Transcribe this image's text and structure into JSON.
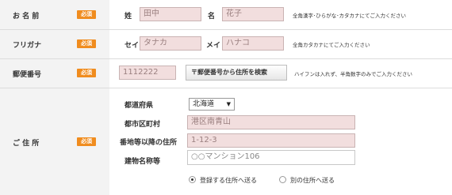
{
  "required_badge": "必須",
  "name": {
    "label": "お 名 前",
    "last_label": "姓",
    "last_value": "田中",
    "first_label": "名",
    "first_value": "花子",
    "hint": "全角漢字･ひらがな･カタカナにてご入力ください"
  },
  "kana": {
    "label": "フリガナ",
    "last_label": "セイ",
    "last_value": "タナカ",
    "first_label": "メイ",
    "first_value": "ハナコ",
    "hint": "全角カタカナにてご入力ください"
  },
  "postal": {
    "label": "郵便番号",
    "value": "1112222",
    "search_button": "〒郵便番号から住所を検索",
    "hint": "ハイフンは入れず、半角数字のみでご入力ください"
  },
  "address": {
    "label": "ご 住 所",
    "prefecture_label": "都道府県",
    "prefecture_value": "北海道",
    "city_label": "都市区町村",
    "city_value": "港区南青山",
    "street_label": "番地等以降の住所",
    "street_value": "1-12-3",
    "building_label": "建物名称等",
    "building_placeholder": "○○マンション106",
    "radio_registered": "登録する住所へ送る",
    "radio_other": "別の住所へ送る",
    "selected": "registered"
  }
}
